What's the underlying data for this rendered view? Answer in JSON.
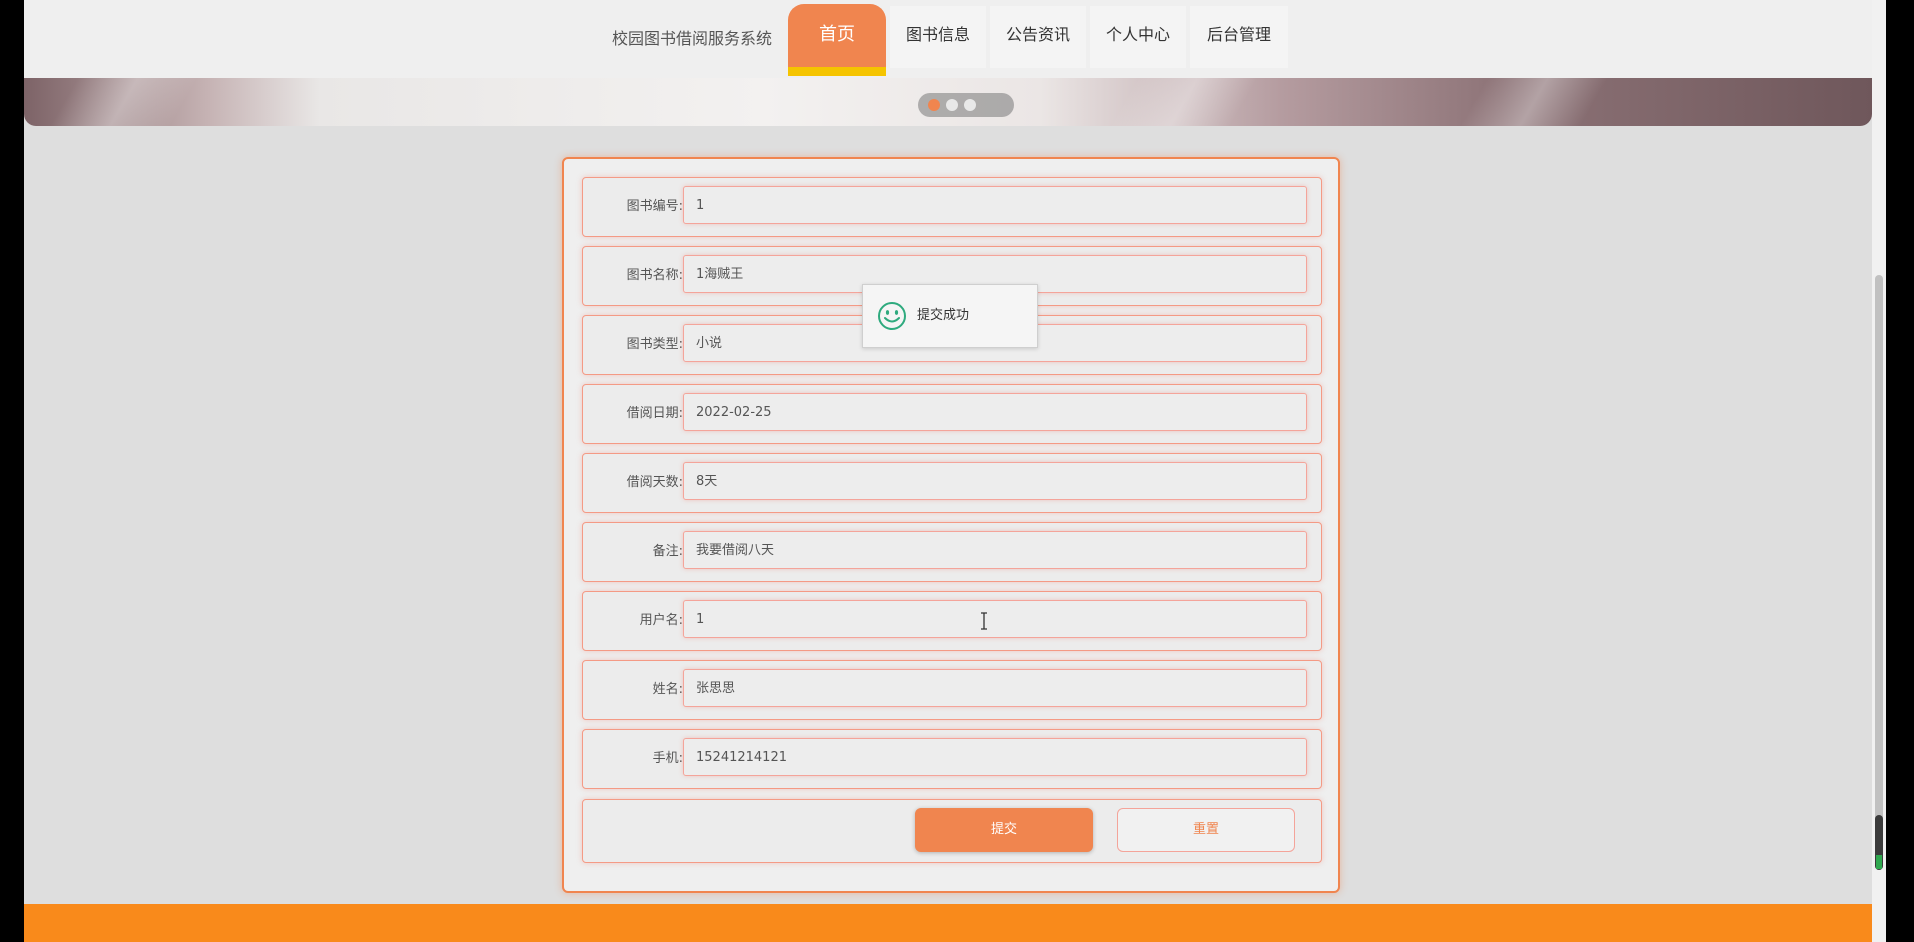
{
  "nav": {
    "site_title": "校园图书借阅服务系统",
    "items": [
      "首页",
      "图书信息",
      "公告资讯",
      "个人中心",
      "后台管理"
    ],
    "active_index": 0
  },
  "banner": {
    "carousel_dots": 3,
    "active_dot": 0
  },
  "form": {
    "fields": [
      {
        "label": "图书编号:",
        "value": "1"
      },
      {
        "label": "图书名称:",
        "value": "1海贼王"
      },
      {
        "label": "图书类型:",
        "value": "小说"
      },
      {
        "label": "借阅日期:",
        "value": "2022-02-25"
      },
      {
        "label": "借阅天数:",
        "value": "8天"
      },
      {
        "label": "备注:",
        "value": "我要借阅八天"
      },
      {
        "label": "用户名:",
        "value": "1"
      },
      {
        "label": "姓名:",
        "value": "张思思"
      },
      {
        "label": "手机:",
        "value": "15241214121"
      }
    ],
    "submit_label": "提交",
    "reset_label": "重置"
  },
  "toast": {
    "icon": "smile-icon",
    "message": "提交成功"
  },
  "colors": {
    "accent": "#f0854f",
    "footer": "#f98a1b",
    "active_underline": "#f5c400",
    "toast_icon": "#2eaa7e"
  }
}
